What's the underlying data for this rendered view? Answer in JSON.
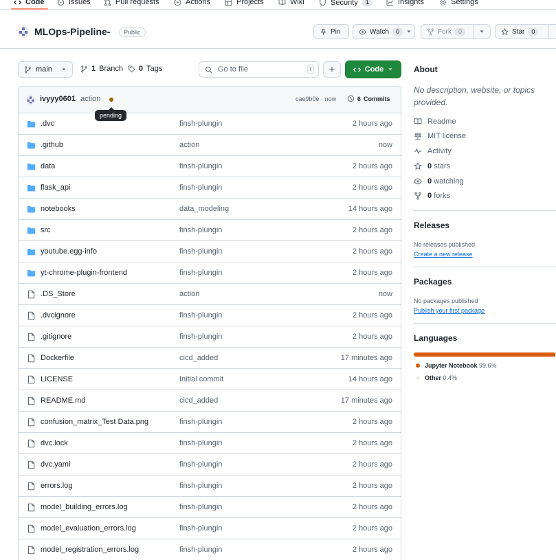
{
  "nav": {
    "items": [
      {
        "label": "Code",
        "icon": "code-icon"
      },
      {
        "label": "Issues",
        "icon": "issue-icon"
      },
      {
        "label": "Pull requests",
        "icon": "pull-request-icon"
      },
      {
        "label": "Actions",
        "icon": "play-icon"
      },
      {
        "label": "Projects",
        "icon": "table-icon"
      },
      {
        "label": "Wiki",
        "icon": "book-icon"
      },
      {
        "label": "Security",
        "icon": "shield-icon",
        "count": "1"
      },
      {
        "label": "Insights",
        "icon": "graph-icon"
      },
      {
        "label": "Settings",
        "icon": "gear-icon"
      }
    ]
  },
  "repo": {
    "name": "MLOps-Pipeline-",
    "visibility": "Public",
    "pin_label": "Pin",
    "watch_label": "Watch",
    "watch_count": "0",
    "fork_label": "Fork",
    "fork_count": "0",
    "star_label": "Star",
    "star_count": "0"
  },
  "toolbar": {
    "branch": "main",
    "branches_count": "1",
    "branches_label": "Branch",
    "tags_count": "0",
    "tags_label": "Tags",
    "goto_placeholder": "Go to file",
    "goto_key": "t",
    "add_label": "+",
    "code_label": "Code"
  },
  "commit": {
    "author": "ivyyy0601",
    "message": "action",
    "status_tooltip": "pending",
    "hash": "cae9b0e",
    "separator": "·",
    "time": "now",
    "commits_count": "6",
    "commits_label": "Commits"
  },
  "files": [
    {
      "name": ".dvc",
      "type": "dir",
      "message": "finsh-plungin",
      "time": "2 hours ago"
    },
    {
      "name": ".github",
      "type": "dir",
      "message": "action",
      "time": "now"
    },
    {
      "name": "data",
      "type": "dir",
      "message": "finsh-plungin",
      "time": "2 hours ago"
    },
    {
      "name": "flask_api",
      "type": "dir",
      "message": "finsh-plungin",
      "time": "2 hours ago"
    },
    {
      "name": "notebooks",
      "type": "dir",
      "message": "data_modeling",
      "time": "14 hours ago"
    },
    {
      "name": "src",
      "type": "dir",
      "message": "finsh-plungin",
      "time": "2 hours ago"
    },
    {
      "name": "youtube.egg-info",
      "type": "dir",
      "message": "finsh-plungin",
      "time": "2 hours ago"
    },
    {
      "name": "yt-chrome-plugin-frontend",
      "type": "dir",
      "message": "finsh-plungin",
      "time": "2 hours ago"
    },
    {
      "name": ".DS_Store",
      "type": "file",
      "message": "action",
      "time": "now"
    },
    {
      "name": ".dvcignore",
      "type": "file",
      "message": "finsh-plungin",
      "time": "2 hours ago"
    },
    {
      "name": ".gitignore",
      "type": "file",
      "message": "finsh-plungin",
      "time": "2 hours ago"
    },
    {
      "name": "Dockerfile",
      "type": "file",
      "message": "cicd_added",
      "time": "17 minutes ago"
    },
    {
      "name": "LICENSE",
      "type": "file",
      "message": "Initial commit",
      "time": "14 hours ago"
    },
    {
      "name": "README.md",
      "type": "file",
      "message": "cicd_added",
      "time": "17 minutes ago"
    },
    {
      "name": "confusion_matrix_Test Data.png",
      "type": "file",
      "message": "finsh-plungin",
      "time": "2 hours ago"
    },
    {
      "name": "dvc.lock",
      "type": "file",
      "message": "finsh-plungin",
      "time": "2 hours ago"
    },
    {
      "name": "dvc.yaml",
      "type": "file",
      "message": "finsh-plungin",
      "time": "2 hours ago"
    },
    {
      "name": "errors.log",
      "type": "file",
      "message": "finsh-plungin",
      "time": "2 hours ago"
    },
    {
      "name": "model_building_errors.log",
      "type": "file",
      "message": "finsh-plungin",
      "time": "2 hours ago"
    },
    {
      "name": "model_evaluation_errors.log",
      "type": "file",
      "message": "finsh-plungin",
      "time": "2 hours ago"
    },
    {
      "name": "model_registration_errors.log",
      "type": "file",
      "message": "finsh-plungin",
      "time": "2 hours ago"
    }
  ],
  "about": {
    "heading": "About",
    "description": "No description, website, or topics provided.",
    "readme_label": "Readme",
    "license_label": "MIT license",
    "activity_label": "Activity",
    "stars_count": "0",
    "stars_label": "stars",
    "watching_count": "0",
    "watching_label": "watching",
    "forks_count": "0",
    "forks_label": "forks"
  },
  "releases": {
    "heading": "Releases",
    "empty_text": "No releases published",
    "create_link": "Create a new release"
  },
  "packages": {
    "heading": "Packages",
    "empty_text": "No packages published",
    "publish_link": "Publish your first package"
  },
  "languages": {
    "heading": "Languages",
    "items": [
      {
        "name": "Jupyter Notebook",
        "percent": "99.6%",
        "share": 0.996,
        "color": "#DA5B0B"
      },
      {
        "name": "Other",
        "percent": "0.4%",
        "share": 0.004,
        "color": "#ededed"
      }
    ]
  },
  "colors": {
    "accent_green": "#1f883d",
    "folder_blue": "#54aeff",
    "link_blue": "#0969da",
    "pending_dot": "#9a6700",
    "tab_underline": "#fd8c73"
  }
}
